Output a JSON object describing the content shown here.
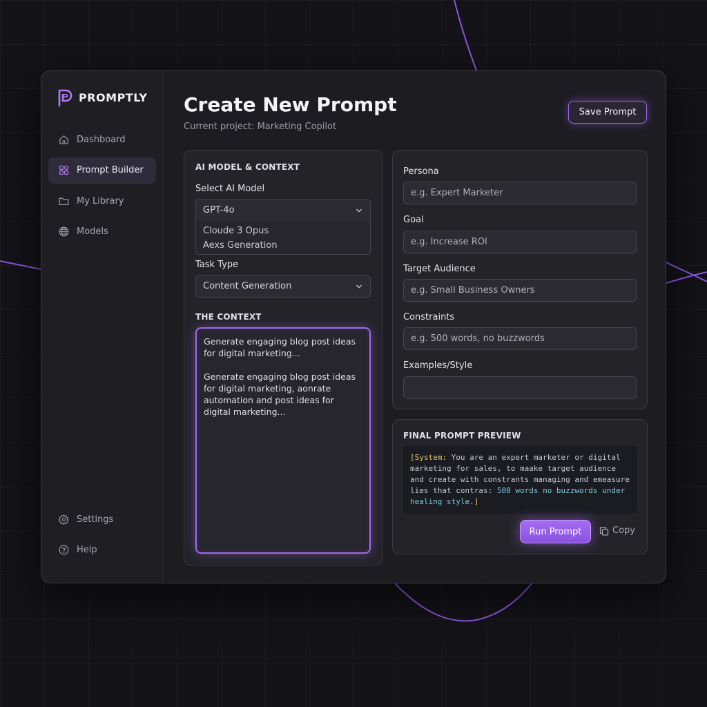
{
  "app": {
    "name": "PROMPTLY"
  },
  "sidebar": {
    "items": [
      {
        "label": "Dashboard",
        "icon": "home-icon"
      },
      {
        "label": "Prompt Builder",
        "icon": "grid-icon",
        "active": true
      },
      {
        "label": "My Library",
        "icon": "folder-icon"
      },
      {
        "label": "Models",
        "icon": "globe-icon"
      }
    ],
    "bottom_items": [
      {
        "label": "Settings",
        "icon": "gear-icon"
      },
      {
        "label": "Help",
        "icon": "help-icon"
      }
    ]
  },
  "header": {
    "title": "Create New Prompt",
    "subtitle": "Current project: Marketing Copilot",
    "save_label": "Save Prompt"
  },
  "model_context": {
    "section_title": "AI MODEL & CONTEXT",
    "model_label": "Select AI Model",
    "model_selected": "GPT-4o",
    "model_options": [
      "Cloude 3 Opus",
      "Aexs Generation"
    ],
    "task_label": "Task Type",
    "task_selected": "Content Generation",
    "context_title": "THE CONTEXT",
    "context_paragraphs": [
      "Generate engaging blog post ideas for digital marketing...",
      "Generate engaging blog post ideas for digital marketing, aonrate automation and post ideas for digital marketing..."
    ]
  },
  "fields": {
    "persona": {
      "label": "Persona",
      "placeholder": "e.g. Expert Marketer"
    },
    "goal": {
      "label": "Goal",
      "placeholder": "e.g. Increase ROI"
    },
    "audience": {
      "label": "Target Audience",
      "placeholder": "e.g. Small Business Owners"
    },
    "constraints": {
      "label": "Constraints",
      "placeholder": "e.g. 500 words, no buzzwords"
    },
    "examples": {
      "label": "Examples/Style",
      "placeholder": ""
    }
  },
  "preview": {
    "title": "FINAL PROMPT PREVIEW",
    "code_open": "[",
    "code_system": "System:",
    "code_body": " You are an expert marketer or digital marketing for sales, to maake target audience and create with constrants managing and emeasure lies that contras: ",
    "code_num": "500 words no buzzwords under healing style.",
    "code_close": "]",
    "run_label": "Run Prompt",
    "copy_label": "Copy"
  },
  "colors": {
    "accent": "#a368f0",
    "background": "#131318",
    "panel": "#232328"
  }
}
